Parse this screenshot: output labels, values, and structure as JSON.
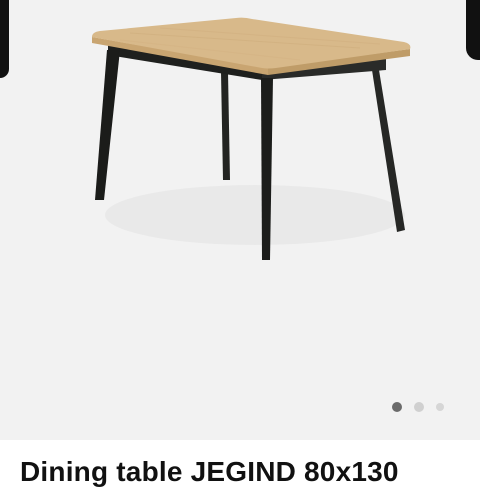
{
  "product": {
    "title": "Dining table JEGIND 80x130",
    "image_alt": "Dining table with oak-look top and black legs"
  },
  "gallery": {
    "image_count": 3,
    "active_index": 0
  },
  "colors": {
    "gallery_background": "#f2f2f2",
    "tabletop": "#d8b98a",
    "legs": "#1e1f1d",
    "dot_active": "#6b6b6b",
    "dot_inactive": "#d0d0d0"
  }
}
